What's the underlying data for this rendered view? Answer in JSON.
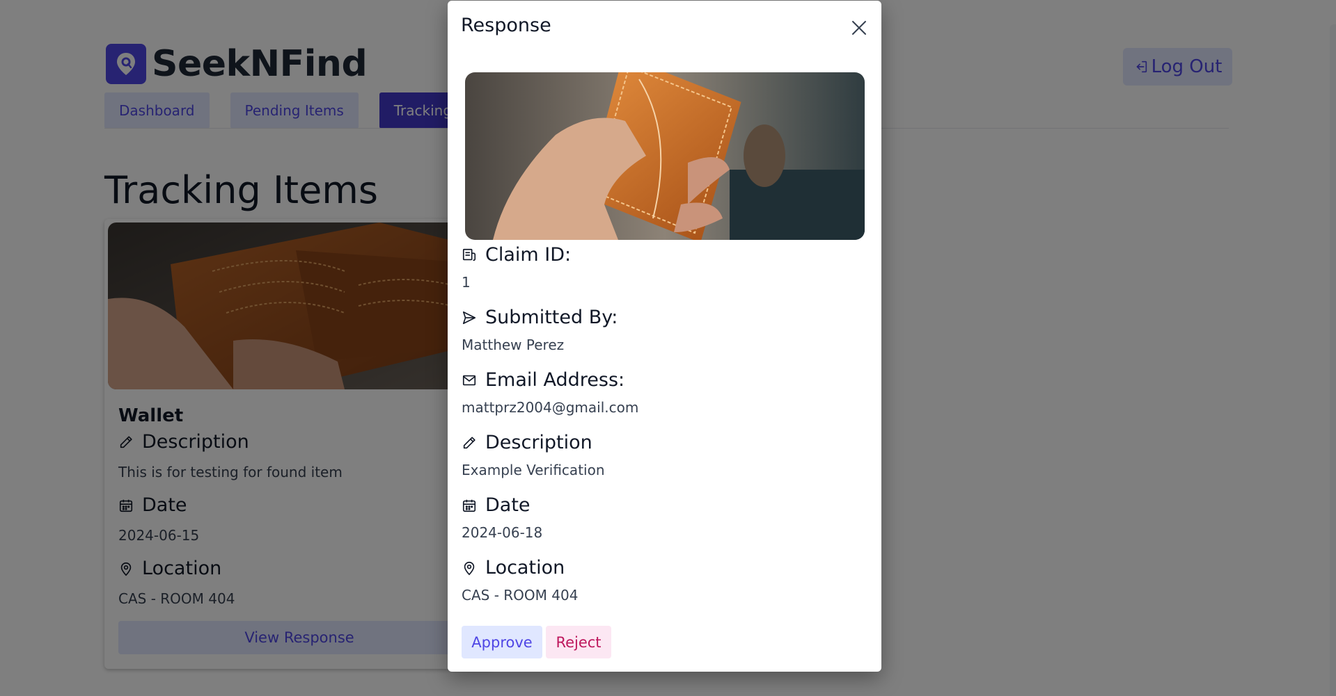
{
  "app": {
    "brand_name": "SeekNFind",
    "logout_label": "Log Out"
  },
  "nav": {
    "tabs": [
      {
        "label": "Dashboard",
        "active": false
      },
      {
        "label": "Pending Items",
        "active": false
      },
      {
        "label": "Tracking Items",
        "active": true
      }
    ]
  },
  "page": {
    "title": "Tracking Items"
  },
  "item_card": {
    "title": "Wallet",
    "description_label": "Description",
    "description": "This is for testing for found item",
    "date_label": "Date",
    "date": "2024-06-15",
    "location_label": "Location",
    "location": "CAS - ROOM 404",
    "view_button": "View Response"
  },
  "modal": {
    "title": "Response",
    "claim_id_label": "Claim ID:",
    "claim_id": "1",
    "submitted_by_label": "Submitted By:",
    "submitted_by": "Matthew Perez",
    "email_label": "Email Address:",
    "email": "mattprz2004@gmail.com",
    "description_label": "Description",
    "description": "Example Verification",
    "date_label": "Date",
    "date": "2024-06-18",
    "location_label": "Location",
    "location": "CAS - ROOM 404",
    "approve_label": "Approve",
    "reject_label": "Reject"
  },
  "icons": {
    "brand": "location-search-icon",
    "logout": "logout-icon",
    "claim": "receipt-icon",
    "submitted": "send-icon",
    "email": "mail-icon",
    "description": "pencil-icon",
    "date": "calendar-icon",
    "location": "map-pin-icon",
    "close": "close-icon"
  },
  "colors": {
    "primary": "#4f46e5",
    "primary_dark": "#4338ca",
    "primary_light": "#e0e7ff",
    "reject_bg": "#fce7f3",
    "reject_text": "#be185d",
    "overlay": "rgba(0,0,0,0.5)"
  }
}
